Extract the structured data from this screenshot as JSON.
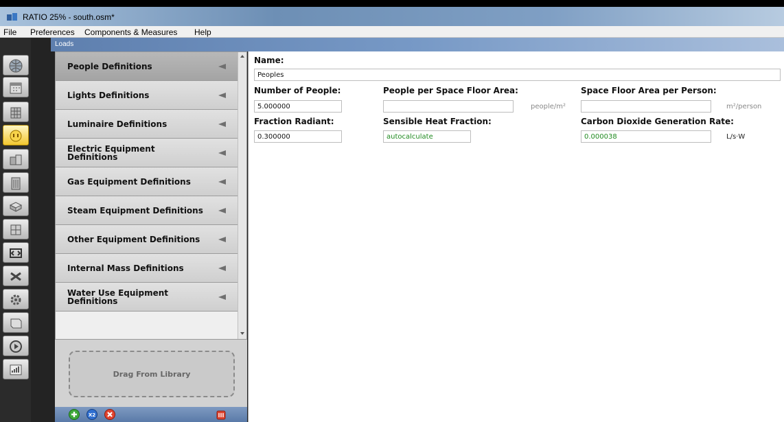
{
  "window": {
    "title": "RATIO 25% - south.osm*"
  },
  "menu": {
    "items": [
      "File",
      "Preferences",
      "Components & Measures",
      "Help"
    ]
  },
  "header": {
    "label": "Loads"
  },
  "tabs": [
    "globe-icon",
    "calendar-icon",
    "building-stack-icon",
    "loads-plug-icon",
    "space-types-icon",
    "building-icon",
    "thermal-zones-icon",
    "geometry-icon",
    "hvac-loop-icon",
    "variables-icon",
    "simulation-settings-icon",
    "scripts-icon",
    "run-icon",
    "results-icon"
  ],
  "definitions": {
    "items": [
      {
        "label": "People Definitions",
        "selected": true
      },
      {
        "label": "Lights Definitions",
        "selected": false
      },
      {
        "label": "Luminaire Definitions",
        "selected": false
      },
      {
        "label": "Electric Equipment Definitions",
        "selected": false
      },
      {
        "label": "Gas Equipment Definitions",
        "selected": false
      },
      {
        "label": "Steam Equipment Definitions",
        "selected": false
      },
      {
        "label": "Other Equipment Definitions",
        "selected": false
      },
      {
        "label": "Internal Mass Definitions",
        "selected": false
      },
      {
        "label": "Water Use Equipment Definitions",
        "selected": false
      }
    ]
  },
  "library": {
    "drop_label": "Drag From Library"
  },
  "toolbar": {
    "icons": [
      "add-icon",
      "copy-icon",
      "remove-icon",
      "purge-icon"
    ]
  },
  "form": {
    "name_label": "Name:",
    "name_value": "Peoples",
    "number_of_people_label": "Number of People:",
    "number_of_people_value": "5.000000",
    "people_per_area_label": "People per Space Floor Area:",
    "people_per_area_value": "",
    "people_per_area_unit": "people/m²",
    "area_per_person_label": "Space Floor Area per Person:",
    "area_per_person_value": "",
    "area_per_person_unit": "m²/person",
    "fraction_radiant_label": "Fraction Radiant:",
    "fraction_radiant_value": "0.300000",
    "sensible_heat_label": "Sensible Heat Fraction:",
    "sensible_heat_value": "autocalculate",
    "co2_label": "Carbon Dioxide Generation Rate:",
    "co2_value": "0.000038",
    "co2_unit": "L/s·W"
  },
  "colors": {
    "accent_blue": "#6a8dbd",
    "active_tab": "#f2c730",
    "autocalc_green": "#1f8a1f"
  }
}
